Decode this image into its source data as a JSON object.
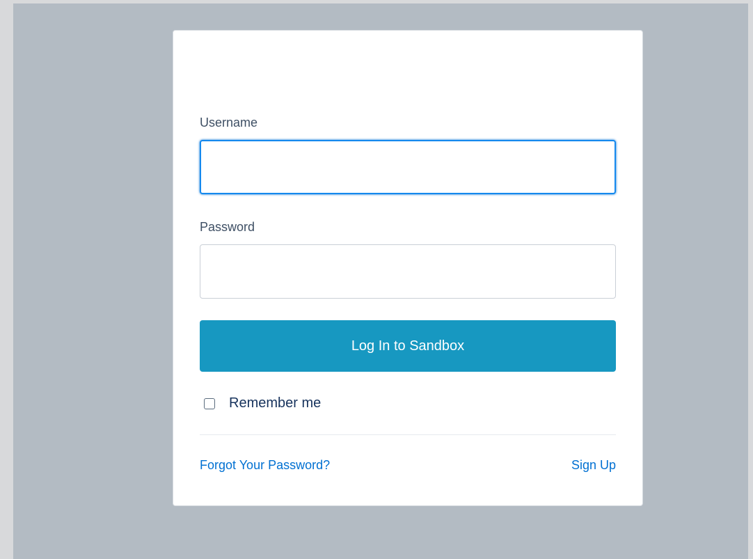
{
  "form": {
    "username_label": "Username",
    "username_value": "",
    "username_placeholder": "",
    "password_label": "Password",
    "password_value": "",
    "password_placeholder": "",
    "login_button": "Log In to Sandbox",
    "remember_label": "Remember me",
    "remember_checked": false,
    "forgot_link": "Forgot Your Password?",
    "signup_link": "Sign Up"
  },
  "colors": {
    "page_background": "#b3bbc3",
    "card_background": "#ffffff",
    "button_primary": "#1798c1",
    "link": "#0070d2",
    "focus_border": "#1589ee",
    "label_text": "#3e4f64"
  }
}
